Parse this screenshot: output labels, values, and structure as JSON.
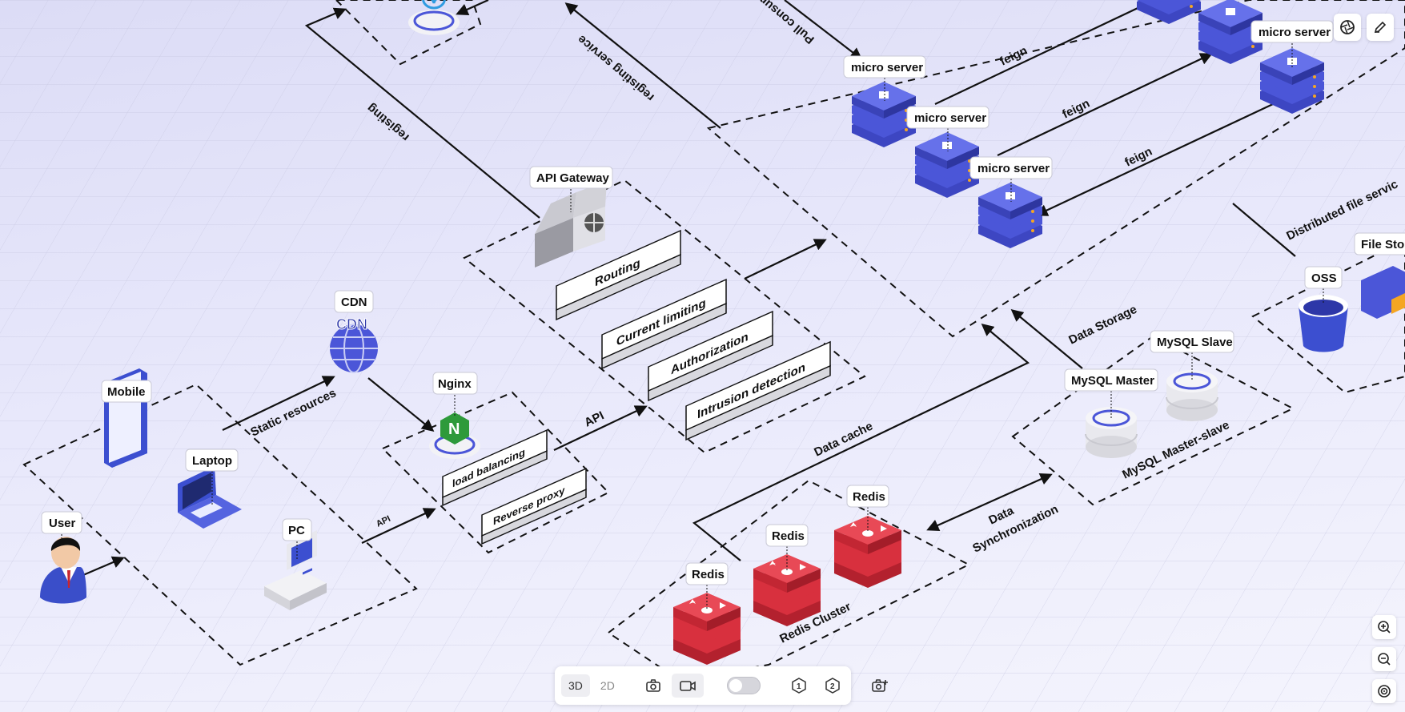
{
  "diagram": {
    "nodes": {
      "user": "User",
      "mobile": "Mobile",
      "laptop": "Laptop",
      "pc": "PC",
      "cdn": "CDN",
      "nginx": "Nginx",
      "api_gateway": "API Gateway",
      "micro_server_1": "micro server",
      "micro_server_2": "micro server",
      "micro_server_3": "micro server",
      "micro_server_4": "micro server",
      "redis_1": "Redis",
      "redis_2": "Redis",
      "redis_3": "Redis",
      "mysql_master": "MySQL Master",
      "mysql_slave": "MySQL Slave",
      "oss": "OSS",
      "file_storage": "File Stor"
    },
    "boxes": {
      "load_balancing": "load balancing",
      "reverse_proxy": "Reverse proxy",
      "routing": "Routing",
      "current_limiting": "Current limiting",
      "authorization": "Authorization",
      "intrusion_detection": "Intrusion detection"
    },
    "groups": {
      "redis_cluster": "Redis Cluster",
      "mysql_master_slave": "MySQL Master-slave",
      "distributed_file_service": "Distributed file servic"
    },
    "edges": {
      "static_resources": "Static resources",
      "api_small": "API",
      "api": "API",
      "registing": "registing",
      "registing_service": "registing service",
      "pull_consume": "Pull consum",
      "feign_1": "feign",
      "feign_2": "feign",
      "feign_3": "feign",
      "data_cache": "Data cache",
      "data_storage": "Data Storage",
      "data_sync_1": "Data",
      "data_sync_2": "Synchronization"
    },
    "colors": {
      "server_blue": "#4b56d8",
      "redis_red": "#d8303e",
      "nginx_green": "#2e9a3b",
      "device_blue": "#3c4fd0"
    }
  },
  "toolbar": {
    "view_3d": "3D",
    "view_2d": "2D",
    "screenshot_icon": "camera-icon",
    "record_icon": "video-icon",
    "step_1": "1",
    "step_2": "2",
    "capture_icon": "camera-plus-icon"
  },
  "top_right": {
    "aperture_icon": "aperture-icon",
    "edit_icon": "pencil-icon"
  },
  "zoom": {
    "zoom_in_icon": "zoom-in-icon",
    "zoom_out_icon": "zoom-out-icon",
    "fit_icon": "target-icon"
  }
}
